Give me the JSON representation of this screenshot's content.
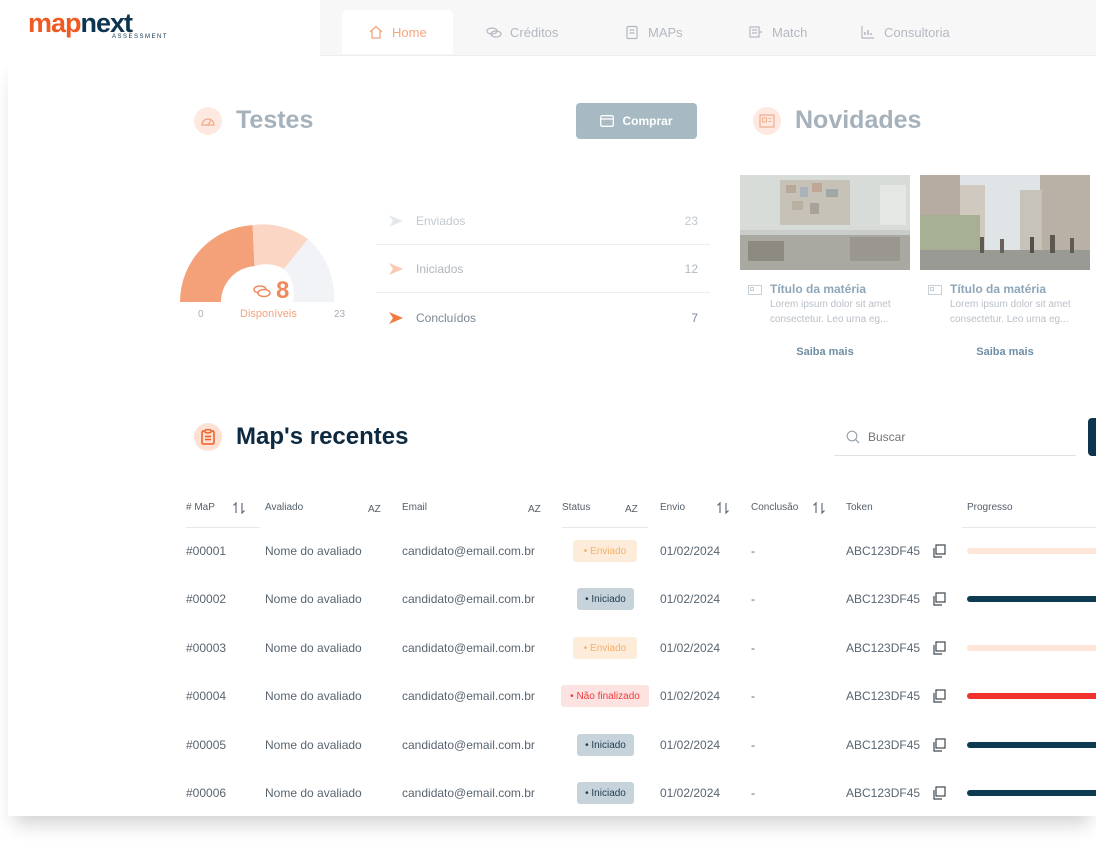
{
  "brand": {
    "logo_map": "map",
    "logo_next": "next",
    "logo_sub": "ASSESSMENT"
  },
  "nav": {
    "tabs": [
      {
        "label": "Home",
        "icon": "home-icon",
        "active": true
      },
      {
        "label": "Créditos",
        "icon": "coins-icon",
        "active": false
      },
      {
        "label": "MAPs",
        "icon": "clipboard-icon",
        "active": false
      },
      {
        "label": "Match",
        "icon": "match-icon",
        "active": false
      },
      {
        "label": "Consultoria",
        "icon": "chart-icon",
        "active": false
      }
    ]
  },
  "tests": {
    "title": "Testes",
    "buy_label": "Comprar",
    "available_count": "8",
    "available_label": "Disponíveis",
    "gauge_min": "0",
    "gauge_max": "23",
    "statuses": [
      {
        "label": "Enviados",
        "value": "23"
      },
      {
        "label": "Iniciados",
        "value": "12"
      },
      {
        "label": "Concluídos",
        "value": "7"
      }
    ]
  },
  "news": {
    "title": "Novidades",
    "cards": [
      {
        "title": "Título da matéria",
        "text": "Lorem ipsum dolor sit amet consectetur. Leo urna eg...",
        "link": "Saiba mais"
      },
      {
        "title": "Título da matéria",
        "text": "Lorem ipsum dolor sit amet consectetur. Leo urna eg...",
        "link": "Saiba mais"
      }
    ]
  },
  "recent": {
    "title": "Map's recentes",
    "search_placeholder": "Buscar",
    "columns": [
      "# MaP",
      "Avaliado",
      "Email",
      "Status",
      "Envio",
      "Conclusão",
      "Token",
      "Progresso"
    ],
    "rows": [
      {
        "id": "#00001",
        "name": "Nome do avaliado",
        "email": "candidato@email.com.br",
        "status": "• Enviado",
        "status_type": "enviado",
        "sent": "01/02/2024",
        "done": "-",
        "token": "ABC123DF45",
        "progress": 0.1
      },
      {
        "id": "#00002",
        "name": "Nome do avaliado",
        "email": "candidato@email.com.br",
        "status": "• Iniciado",
        "status_type": "iniciado",
        "sent": "01/02/2024",
        "done": "-",
        "token": "ABC123DF45",
        "progress": 0.5
      },
      {
        "id": "#00003",
        "name": "Nome do avaliado",
        "email": "candidato@email.com.br",
        "status": "• Enviado",
        "status_type": "enviado",
        "sent": "01/02/2024",
        "done": "-",
        "token": "ABC123DF45",
        "progress": 0.1
      },
      {
        "id": "#00004",
        "name": "Nome do avaliado",
        "email": "candidato@email.com.br",
        "status": "• Não finalizado",
        "status_type": "nao",
        "sent": "01/02/2024",
        "done": "-",
        "token": "ABC123DF45",
        "progress": 0.5
      },
      {
        "id": "#00005",
        "name": "Nome do avaliado",
        "email": "candidato@email.com.br",
        "status": "• Iniciado",
        "status_type": "iniciado",
        "sent": "01/02/2024",
        "done": "-",
        "token": "ABC123DF45",
        "progress": 0.5
      },
      {
        "id": "#00006",
        "name": "Nome do avaliado",
        "email": "candidato@email.com.br",
        "status": "• Iniciado",
        "status_type": "iniciado",
        "sent": "01/02/2024",
        "done": "-",
        "token": "ABC123DF45",
        "progress": 0.5
      }
    ]
  },
  "colors": {
    "accent": "#f05a22",
    "navy": "#0e3550",
    "enviado": "#fde6d8",
    "iniciado": "#0e3a52",
    "nao_finalizado": "#f0322b"
  }
}
